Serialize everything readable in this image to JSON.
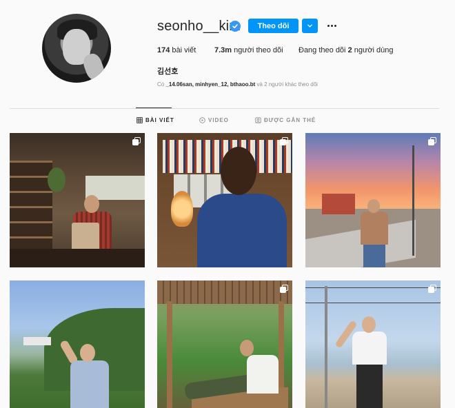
{
  "profile": {
    "username": "seonho__kim",
    "follow_label": "Theo dõi",
    "full_name": "김선호",
    "stats": {
      "posts_count": "174",
      "posts_label": " bài viết",
      "followers_count": "7.3m",
      "followers_label": " người theo dõi",
      "following_prefix": "Đang theo dõi ",
      "following_count": "2",
      "following_suffix": " người dùng"
    },
    "followed_by": {
      "prefix": "Có ",
      "names": "_14.06san, minhyen_12, bthaoo.bt",
      "suffix": " và 2 người khác theo dõi"
    }
  },
  "tabs": [
    {
      "label": "BÀI VIẾT",
      "icon": "grid-icon",
      "active": true
    },
    {
      "label": "VIDEO",
      "icon": "play-icon",
      "active": false
    },
    {
      "label": "ĐƯỢC GẮN THẺ",
      "icon": "tag-icon",
      "active": false
    }
  ],
  "colors": {
    "accent": "#0095f6",
    "verified": "#3897f0",
    "text": "#262626",
    "muted": "#8e8e8e",
    "border": "#dbdbdb",
    "background": "#fafafa"
  },
  "posts": [
    {
      "scene": "cafe-counter",
      "multi_image": true
    },
    {
      "scene": "back-view-bookshelf",
      "multi_image": true
    },
    {
      "scene": "sunset-lamppost",
      "multi_image": true
    },
    {
      "scene": "mountain-peace-sign",
      "multi_image": false
    },
    {
      "scene": "wooden-gazebo",
      "multi_image": true
    },
    {
      "scene": "beach-string-lights",
      "multi_image": true
    }
  ]
}
